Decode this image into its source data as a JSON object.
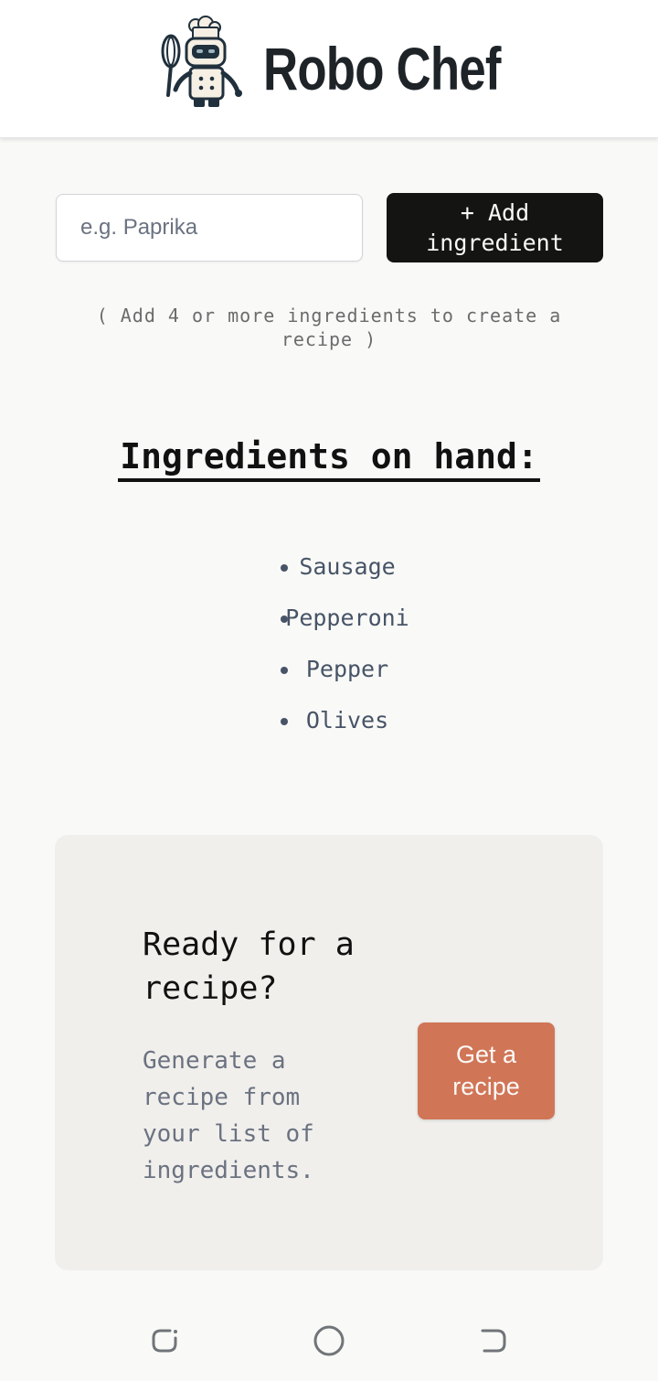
{
  "header": {
    "app_title": "Robo Chef",
    "logo_icon": "robot-chef-logo-icon"
  },
  "form": {
    "input_value": "",
    "input_placeholder": "e.g. Paprika",
    "add_button_label": "+ Add ingredient"
  },
  "hint": "( Add 4 or more ingredients to create a recipe )",
  "ingredients": {
    "title": "Ingredients on hand:",
    "items": [
      "Sausage",
      "Pepperoni",
      "Pepper",
      "Olives"
    ]
  },
  "recipe_card": {
    "title": "Ready for a recipe?",
    "text": "Generate a recipe from your list of ingredients.",
    "button_label": "Get a recipe"
  },
  "nav": {
    "icons": [
      "recent-apps-icon",
      "home-icon",
      "back-icon"
    ]
  },
  "colors": {
    "background": "#f9f9f7",
    "header": "#ffffff",
    "title_text": "#1e2328",
    "add_button": "#141413",
    "card_background": "#f0efec",
    "recipe_button": "#d17557",
    "list_text": "#475467",
    "muted_text": "#6b7280"
  }
}
